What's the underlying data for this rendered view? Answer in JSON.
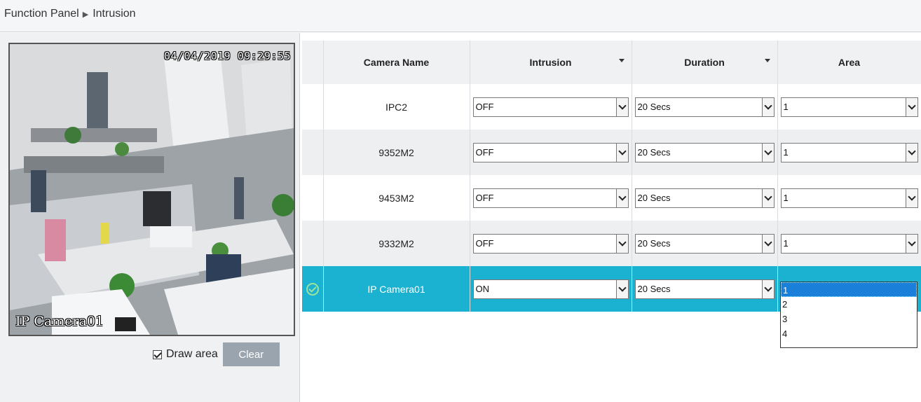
{
  "breadcrumb": {
    "root": "Function Panel",
    "current": "Intrusion"
  },
  "preview": {
    "timestamp": "04/04/2019 09:29:55",
    "camera_label": "IP Camera01"
  },
  "draw": {
    "checkbox_checked": true,
    "label": "Draw area",
    "clear_label": "Clear"
  },
  "table": {
    "headers": {
      "camera": "Camera Name",
      "intrusion": "Intrusion",
      "duration": "Duration",
      "area": "Area"
    },
    "rows": [
      {
        "name": "IPC2",
        "intrusion": "OFF",
        "duration": "20 Secs",
        "area": "1"
      },
      {
        "name": "9352M2",
        "intrusion": "OFF",
        "duration": "20 Secs",
        "area": "1"
      },
      {
        "name": "9453M2",
        "intrusion": "OFF",
        "duration": "20 Secs",
        "area": "1"
      },
      {
        "name": "9332M2",
        "intrusion": "OFF",
        "duration": "20 Secs",
        "area": "1"
      },
      {
        "name": "IP Camera01",
        "intrusion": "ON",
        "duration": "20 Secs",
        "area": ""
      }
    ]
  },
  "area_dropdown": {
    "options": [
      "1",
      "2",
      "3",
      "4"
    ],
    "highlighted": "1"
  },
  "colors": {
    "selected_row": "#1ab2d0",
    "clear_button": "#9aa4ae",
    "dropdown_highlight": "#1a7fd9"
  }
}
